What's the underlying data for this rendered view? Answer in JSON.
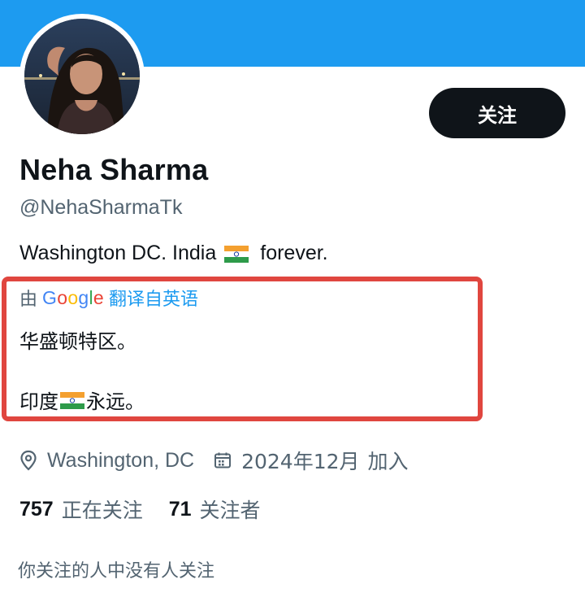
{
  "profile": {
    "follow_label": "关注",
    "display_name": "Neha Sharma",
    "handle": "@NehaSharmaTk",
    "bio_part1": "Washington DC.  India",
    "bio_part2": "forever."
  },
  "translation": {
    "by_label": "由",
    "google_letters": [
      "G",
      "o",
      "o",
      "g",
      "l",
      "e"
    ],
    "from_label": "翻译自英语",
    "line1": "华盛顿特区。",
    "line2_prefix": "印度",
    "line2_suffix": "永远。"
  },
  "meta": {
    "location": "Washington, DC",
    "joined_date": "2024年12月",
    "joined_label": "加入",
    "location_icon": "map-pin-icon",
    "joined_icon": "calendar-icon"
  },
  "stats": {
    "following_count": "757",
    "following_label": "正在关注",
    "followers_count": "71",
    "followers_label": "关注者"
  },
  "followed_by_text": "你关注的人中没有人关注",
  "colors": {
    "banner": "#1d9bf0",
    "highlight_box": "#e0463f",
    "secondary_text": "#536471",
    "link": "#1d9bf0"
  }
}
